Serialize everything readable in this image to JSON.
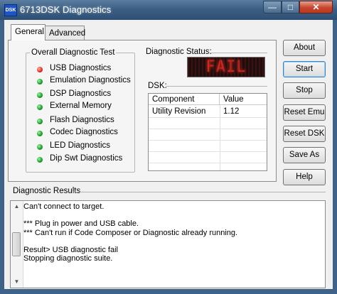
{
  "window": {
    "title": "6713DSK Diagnostics",
    "icon_text": "DSK",
    "controls": {
      "minimize": "—",
      "maximize": "□",
      "close": "✕"
    }
  },
  "tabs": [
    {
      "label": "General",
      "selected": true
    },
    {
      "label": "Advanced",
      "selected": false
    }
  ],
  "diagnostics": {
    "group_title": "Overall Diagnostic Test",
    "items": [
      {
        "label": "USB Diagnostics",
        "status": "red"
      },
      {
        "label": "Emulation Diagnostics",
        "status": "green"
      },
      {
        "label": "DSP Diagnostics",
        "status": "green"
      },
      {
        "label": "External Memory",
        "status": "green"
      },
      {
        "label": "Flash Diagnostics",
        "status": "green"
      },
      {
        "label": "Codec Diagnostics",
        "status": "green"
      },
      {
        "label": "LED Diagnostics",
        "status": "green"
      },
      {
        "label": "Dip Swt Diagnostics",
        "status": "green"
      }
    ]
  },
  "status": {
    "label": "Diagnostic Status:",
    "display": "FAIL",
    "color": "#d8261b"
  },
  "dsk": {
    "label": "DSK:",
    "columns": [
      "Component",
      "Value"
    ],
    "rows": [
      [
        "Utility Revision",
        "1.12"
      ]
    ]
  },
  "buttons": {
    "about": "About",
    "start": "Start",
    "stop": "Stop",
    "reset_emu": "Reset Emu",
    "reset_dsk": "Reset DSK",
    "save_as": "Save As",
    "help": "Help"
  },
  "results": {
    "label": "Diagnostic Results",
    "lines": [
      "Can't connect to target.",
      "",
      "*** Plug in power and USB cable.",
      "*** Can't run if Code Composer or Diagnostic already running.",
      "",
      "Result> USB diagnostic fail",
      "Stopping diagnostic suite."
    ]
  }
}
